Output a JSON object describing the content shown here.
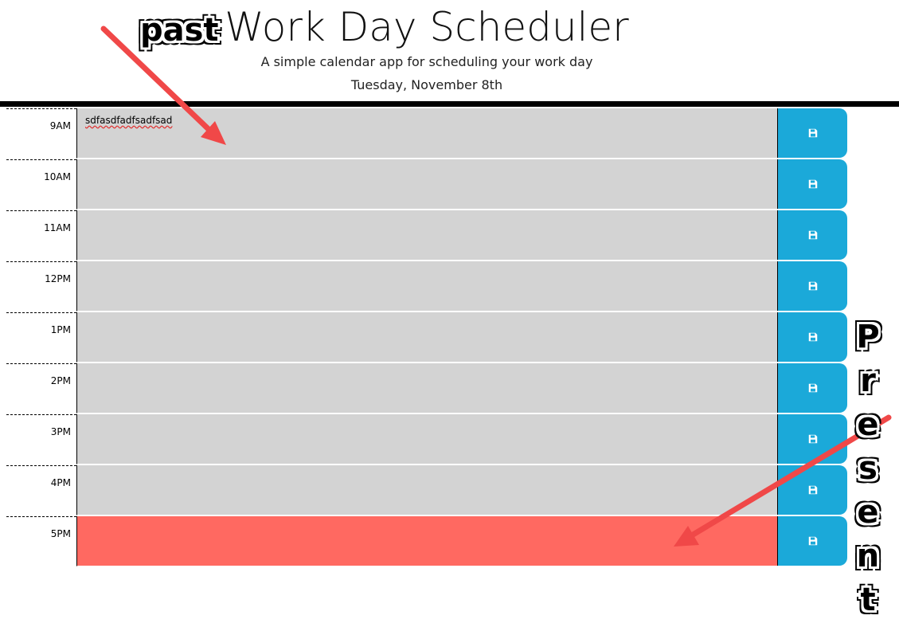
{
  "header": {
    "title": "Work Day Scheduler",
    "subtitle": "A simple calendar app for scheduling your work day",
    "date": "Tuesday, November 8th"
  },
  "rows": [
    {
      "hour": "9AM",
      "text": "sdfasdfadfsadfsad",
      "state": "past"
    },
    {
      "hour": "10AM",
      "text": "",
      "state": "past"
    },
    {
      "hour": "11AM",
      "text": "",
      "state": "past"
    },
    {
      "hour": "12PM",
      "text": "",
      "state": "past"
    },
    {
      "hour": "1PM",
      "text": "",
      "state": "past"
    },
    {
      "hour": "2PM",
      "text": "",
      "state": "past"
    },
    {
      "hour": "3PM",
      "text": "",
      "state": "past"
    },
    {
      "hour": "4PM",
      "text": "",
      "state": "past"
    },
    {
      "hour": "5PM",
      "text": "",
      "state": "present"
    }
  ],
  "save_icon": "save-icon",
  "annotations": {
    "past": "past",
    "present": "Present"
  },
  "colors": {
    "past": "#d3d3d3",
    "present": "#ff6961",
    "save_button": "#1ba9d9",
    "arrow": "#f04848"
  }
}
